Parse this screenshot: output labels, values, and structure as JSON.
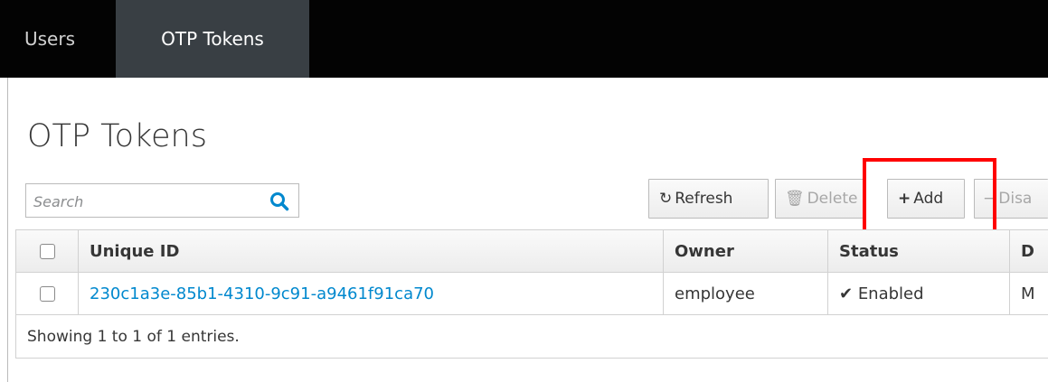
{
  "nav": {
    "tabs": [
      {
        "label": "Users"
      },
      {
        "label": "OTP Tokens"
      }
    ]
  },
  "page": {
    "title": "OTP Tokens"
  },
  "search": {
    "placeholder": "Search",
    "icon": "search-icon"
  },
  "toolbar": {
    "refresh_label": "Refresh",
    "delete_label": "Delete",
    "add_label": "Add",
    "disable_label": "Disa"
  },
  "table": {
    "columns": [
      "Unique ID",
      "Owner",
      "Status",
      "D"
    ],
    "rows": [
      {
        "unique_id": "230c1a3e-85b1-4310-9c91-a9461f91ca70",
        "owner": "employee",
        "status": "Enabled",
        "d": "M"
      }
    ],
    "footer": "Showing 1 to 1 of 1 entries."
  },
  "colors": {
    "accent": "#0088ce",
    "highlight": "#ff0000",
    "nav_bg": "#030303",
    "active_tab": "#393f44"
  }
}
